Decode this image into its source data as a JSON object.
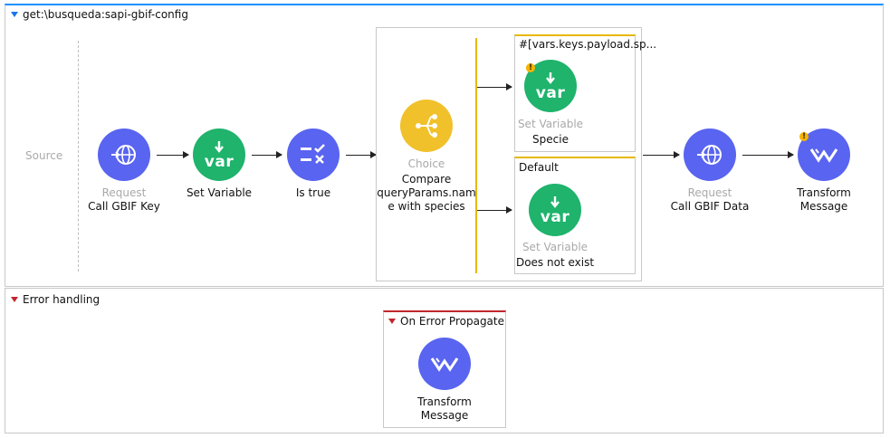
{
  "flow": {
    "title": "get:\\busqueda:sapi-gbif-config",
    "source_label": "Source",
    "processors": {
      "request1": {
        "type": "Request",
        "name": "Call GBIF Key",
        "icon": "http-request-icon"
      },
      "setvar1": {
        "type": "",
        "name": "Set Variable",
        "icon": "var-icon",
        "icon_text": "var"
      },
      "istrue": {
        "type": "",
        "name": "Is true",
        "icon": "validation-icon"
      },
      "choice": {
        "type": "Choice",
        "name_line1": "Compare",
        "name_line2": "queryParams.nam",
        "name_line3": "e with species",
        "icon": "choice-router-icon"
      },
      "request2": {
        "type": "Request",
        "name": "Call GBIF Data",
        "icon": "http-request-icon"
      },
      "transform1": {
        "type": "",
        "name_line1": "Transform",
        "name_line2": "Message",
        "icon": "transform-icon"
      }
    },
    "choice_routes": [
      {
        "condition": "#[vars.keys.payload.sp...",
        "type": "Set Variable",
        "name": "Specie",
        "icon_text": "var",
        "warning": true
      },
      {
        "condition": "Default",
        "type": "Set Variable",
        "name": "Does not exist",
        "icon_text": "var",
        "warning": false
      }
    ],
    "colors": {
      "blue": "#5964f0",
      "green": "#1fb36c",
      "yellow": "#f0c12b",
      "route_border": "#e8b800",
      "header_blue": "#1e90ff",
      "error_red": "#c0262d"
    }
  },
  "error_handling": {
    "title": "Error handling",
    "handler_title": "On Error Propagate",
    "transform": {
      "name_line1": "Transform",
      "name_line2": "Message",
      "icon": "transform-icon"
    }
  }
}
